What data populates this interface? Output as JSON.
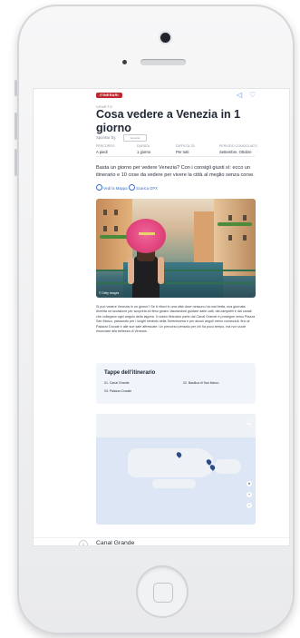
{
  "article": {
    "category_badge": "ITINERARI",
    "section_label": "VENETO",
    "title": "Cosa vedere a Venezia in 1 giorno",
    "sponsor_label": "Sponsor by:",
    "sponsor_logo": "Venezia",
    "meta": [
      {
        "label": "PERCORSO",
        "value": "A piedi"
      },
      {
        "label": "DURATA",
        "value": "1 giorno"
      },
      {
        "label": "DIFFICOLTÀ",
        "value": "Per tutti"
      },
      {
        "label": "PERIODO CONSIGLIATO",
        "value": "Settembre, Ottobre"
      }
    ],
    "lead": "Basta un giorno per vedere Venezia? Con i consigli giusti sì: ecco un itinerario e 10 cose da vedere per vivere la città al meglio senza corse.",
    "link_map": "Vedi la Mappa",
    "link_gpx": "Scarica GPX",
    "photo_credit": "© Getty Images",
    "body_text": "Si può vedere Venezia in un giorno? Se ti ritrovi in una città dove nessuno ha mai fretta, una giornata diventa un'occasione per scoprirla al ritmo giusto: lasciandosi guidare dalle calli, dai campielli e dai canali che collegano ogni angolo della laguna. Il nostro itinerario parte dal Canal Grande e prosegue verso Piazza San Marco, passando per i luoghi simbolo della Serenissima e per alcuni angoli meno conosciuti, fino al Palazzo Ducale e alle sue sale affrescate. Un percorso pensato per chi ha poco tempo, ma non vuole rinunciare alla bellezza di Venezia."
  },
  "tappe": {
    "title": "Tappe dell'itinerario",
    "stops": [
      "01. Canal Grande",
      "02. Basilica di San Marco",
      "03. Palazzo Ducale"
    ]
  },
  "map": {
    "zoom_in": "+",
    "zoom_out": "−"
  },
  "section": {
    "number": "1",
    "title": "Canal Grande"
  },
  "colors": {
    "accent": "#c0262d",
    "link": "#3b6fc6",
    "pin": "#2c4c86"
  }
}
